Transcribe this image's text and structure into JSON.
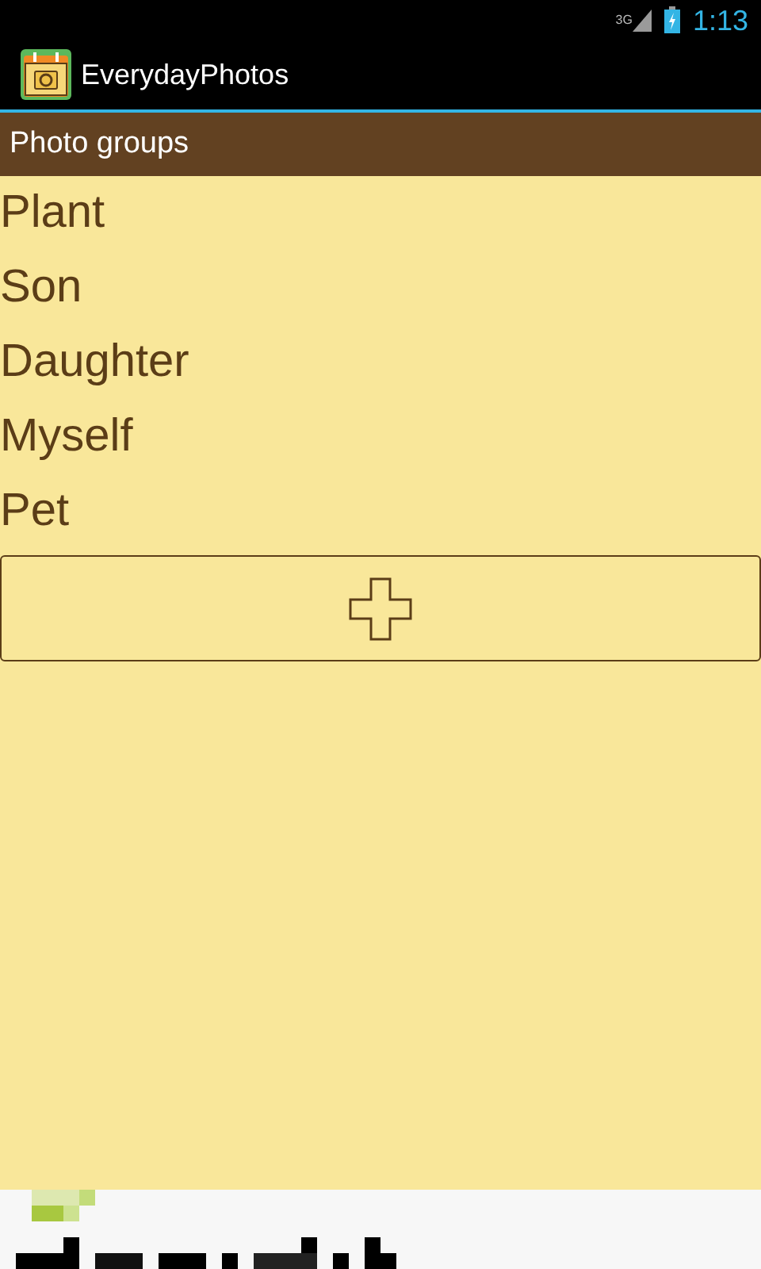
{
  "status_bar": {
    "network": "3G",
    "time": "1:13"
  },
  "action_bar": {
    "title": "EverydayPhotos"
  },
  "section_header": {
    "title": "Photo groups"
  },
  "groups": [
    {
      "label": "Plant"
    },
    {
      "label": "Son"
    },
    {
      "label": "Daughter"
    },
    {
      "label": "Myself"
    },
    {
      "label": "Pet"
    }
  ]
}
